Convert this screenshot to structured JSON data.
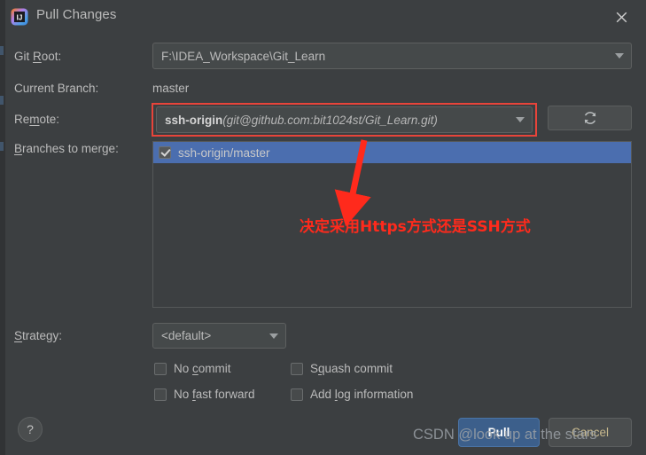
{
  "window": {
    "title": "Pull Changes",
    "app_icon": "intellij-idea-icon",
    "close_icon": "close-icon"
  },
  "form": {
    "git_root": {
      "label": "Git Root:",
      "label_prefix": "Git ",
      "mnemonic": "R",
      "label_suffix": "oot:",
      "value": "F:\\IDEA_Workspace\\Git_Learn"
    },
    "current_branch": {
      "label": "Current Branch:",
      "value": "master"
    },
    "remote": {
      "label_prefix": "Re",
      "mnemonic": "m",
      "label_suffix": "ote:",
      "name": "ssh-origin",
      "url": "(git@github.com:bit1024st/Git_Learn.git)",
      "refresh_icon": "refresh-icon"
    },
    "branches": {
      "mnemonic": "B",
      "label_suffix": "ranches to merge:",
      "items": [
        {
          "label": "ssh-origin/master",
          "checked": true,
          "selected": true
        }
      ]
    },
    "strategy": {
      "mnemonic": "S",
      "label_suffix": "trategy:",
      "value": "<default>"
    },
    "options": [
      {
        "label_prefix": "No ",
        "mnemonic": "c",
        "label_suffix": "ommit",
        "checked": false
      },
      {
        "label_prefix": "S",
        "mnemonic": "q",
        "label_suffix": "uash commit",
        "checked": false
      },
      {
        "label_prefix": "No ",
        "mnemonic": "f",
        "label_suffix": "ast forward",
        "checked": false
      },
      {
        "label_prefix": "Add ",
        "mnemonic": "l",
        "label_suffix": "og information",
        "checked": false
      }
    ]
  },
  "footer": {
    "help_label": "?",
    "pull_label": "Pull",
    "cancel_label": "Cancel"
  },
  "annotation": {
    "text": "决定采用Https方式还是SSH方式",
    "color": "#ff2a1c",
    "arrow_icon": "down-arrow-icon",
    "highlight_box_color": "#e8443a"
  },
  "watermark": {
    "text": "CSDN @look up at the stars"
  }
}
